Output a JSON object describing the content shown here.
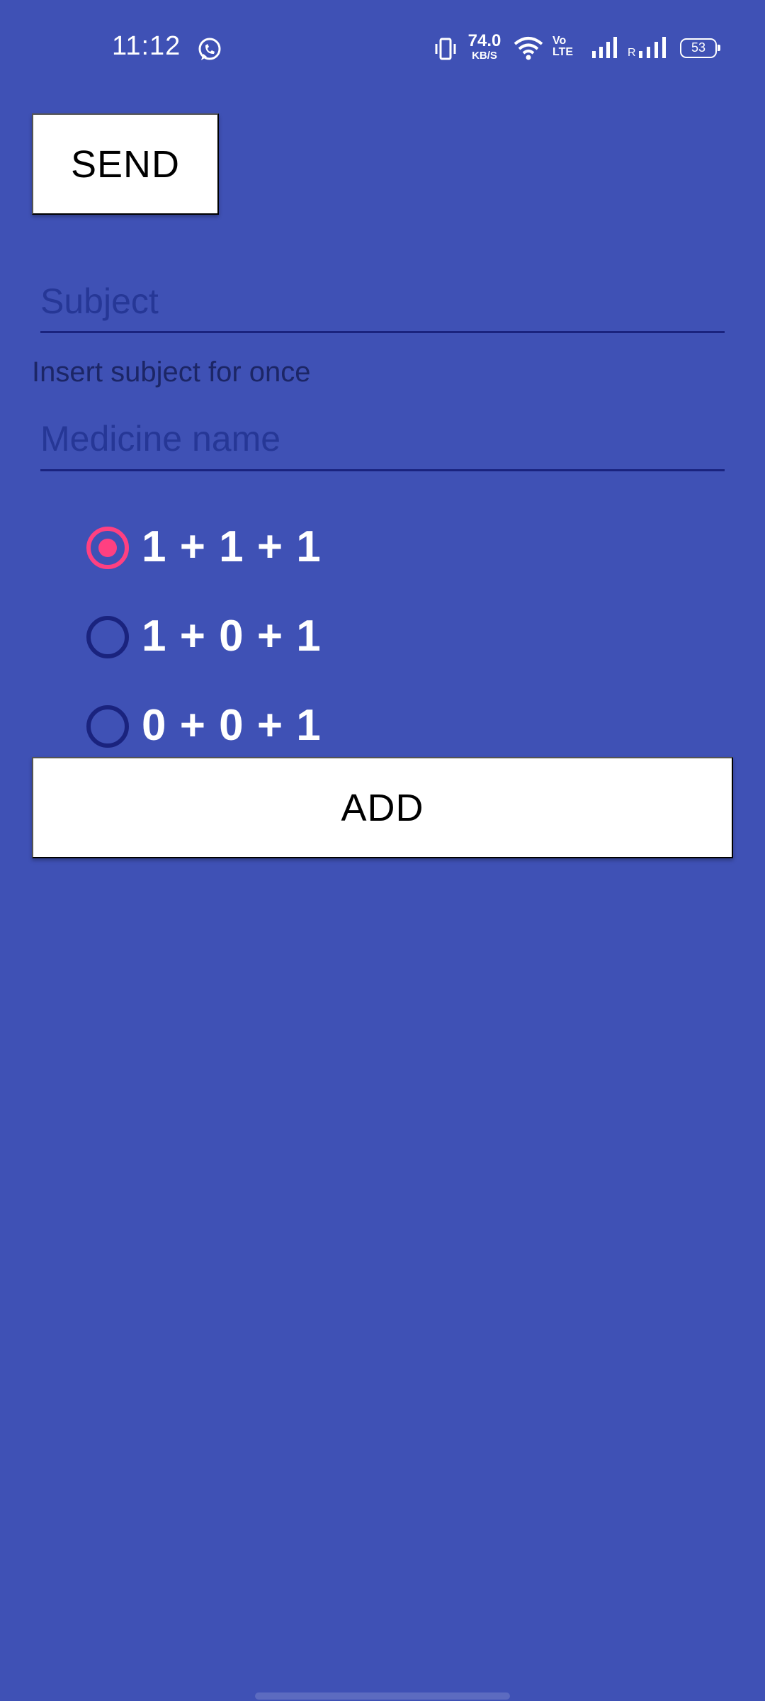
{
  "status_bar": {
    "time": "11:12",
    "network_speed_value": "74.0",
    "network_speed_unit": "KB/S",
    "volte_line1": "Vo",
    "volte_line2": "LTE",
    "roaming_label": "R",
    "battery": "53"
  },
  "form": {
    "send_label": "SEND",
    "subject_placeholder": "Subject",
    "subject_value": "",
    "hint": "Insert subject for once",
    "medicine_placeholder": "Medicine name",
    "medicine_value": "",
    "dosage_options": [
      {
        "label": "1 + 1 + 1",
        "checked": true
      },
      {
        "label": "1 + 0 + 1",
        "checked": false
      },
      {
        "label": "0 + 0 + 1",
        "checked": false
      }
    ],
    "add_label": "ADD"
  },
  "colors": {
    "background": "#3f51b5",
    "accent": "#ff4081",
    "text_dark": "#1a237e",
    "button_bg": "#ffffff"
  },
  "icons": {
    "status": [
      "whatsapp-icon",
      "vibrate-icon",
      "wifi-icon",
      "signal-icon",
      "battery-icon"
    ]
  }
}
